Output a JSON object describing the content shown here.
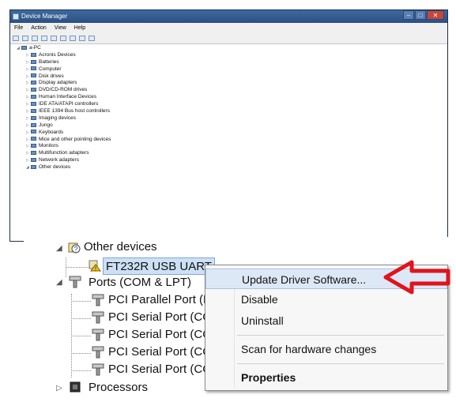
{
  "window": {
    "title": "Device Manager"
  },
  "menu": [
    "File",
    "Action",
    "View",
    "Help"
  ],
  "tree": {
    "root": "a-PC",
    "items": [
      "Acronis Devices",
      "Batteries",
      "Computer",
      "Disk drives",
      "Display adapters",
      "DVD/CD-ROM drives",
      "Human Interface Devices",
      "IDE ATA/ATAPI controllers",
      "IEEE 1394 Bus host controllers",
      "Imaging devices",
      "Jungo",
      "Keyboards",
      "Mice and other pointing devices",
      "Monitors",
      "Multifunction adapters",
      "Network adapters",
      "Other devices"
    ]
  },
  "zoom": {
    "other_devices": "Other devices",
    "ft232r": "FT232R USB UART",
    "ports": "Ports (COM & LPT)",
    "ports_items": [
      "PCI Parallel Port (L",
      "PCI Serial Port (CC",
      "PCI Serial Port (CC",
      "PCI Serial Port (CC",
      "PCI Serial Port (CC"
    ],
    "processors": "Processors"
  },
  "context_menu": {
    "update": "Update Driver Software...",
    "disable": "Disable",
    "uninstall": "Uninstall",
    "scan": "Scan for hardware changes",
    "properties": "Properties"
  },
  "colors": {
    "arrow": "#e0141c",
    "titlebar": "#2b4f82",
    "highlight": "#dde8f6"
  }
}
